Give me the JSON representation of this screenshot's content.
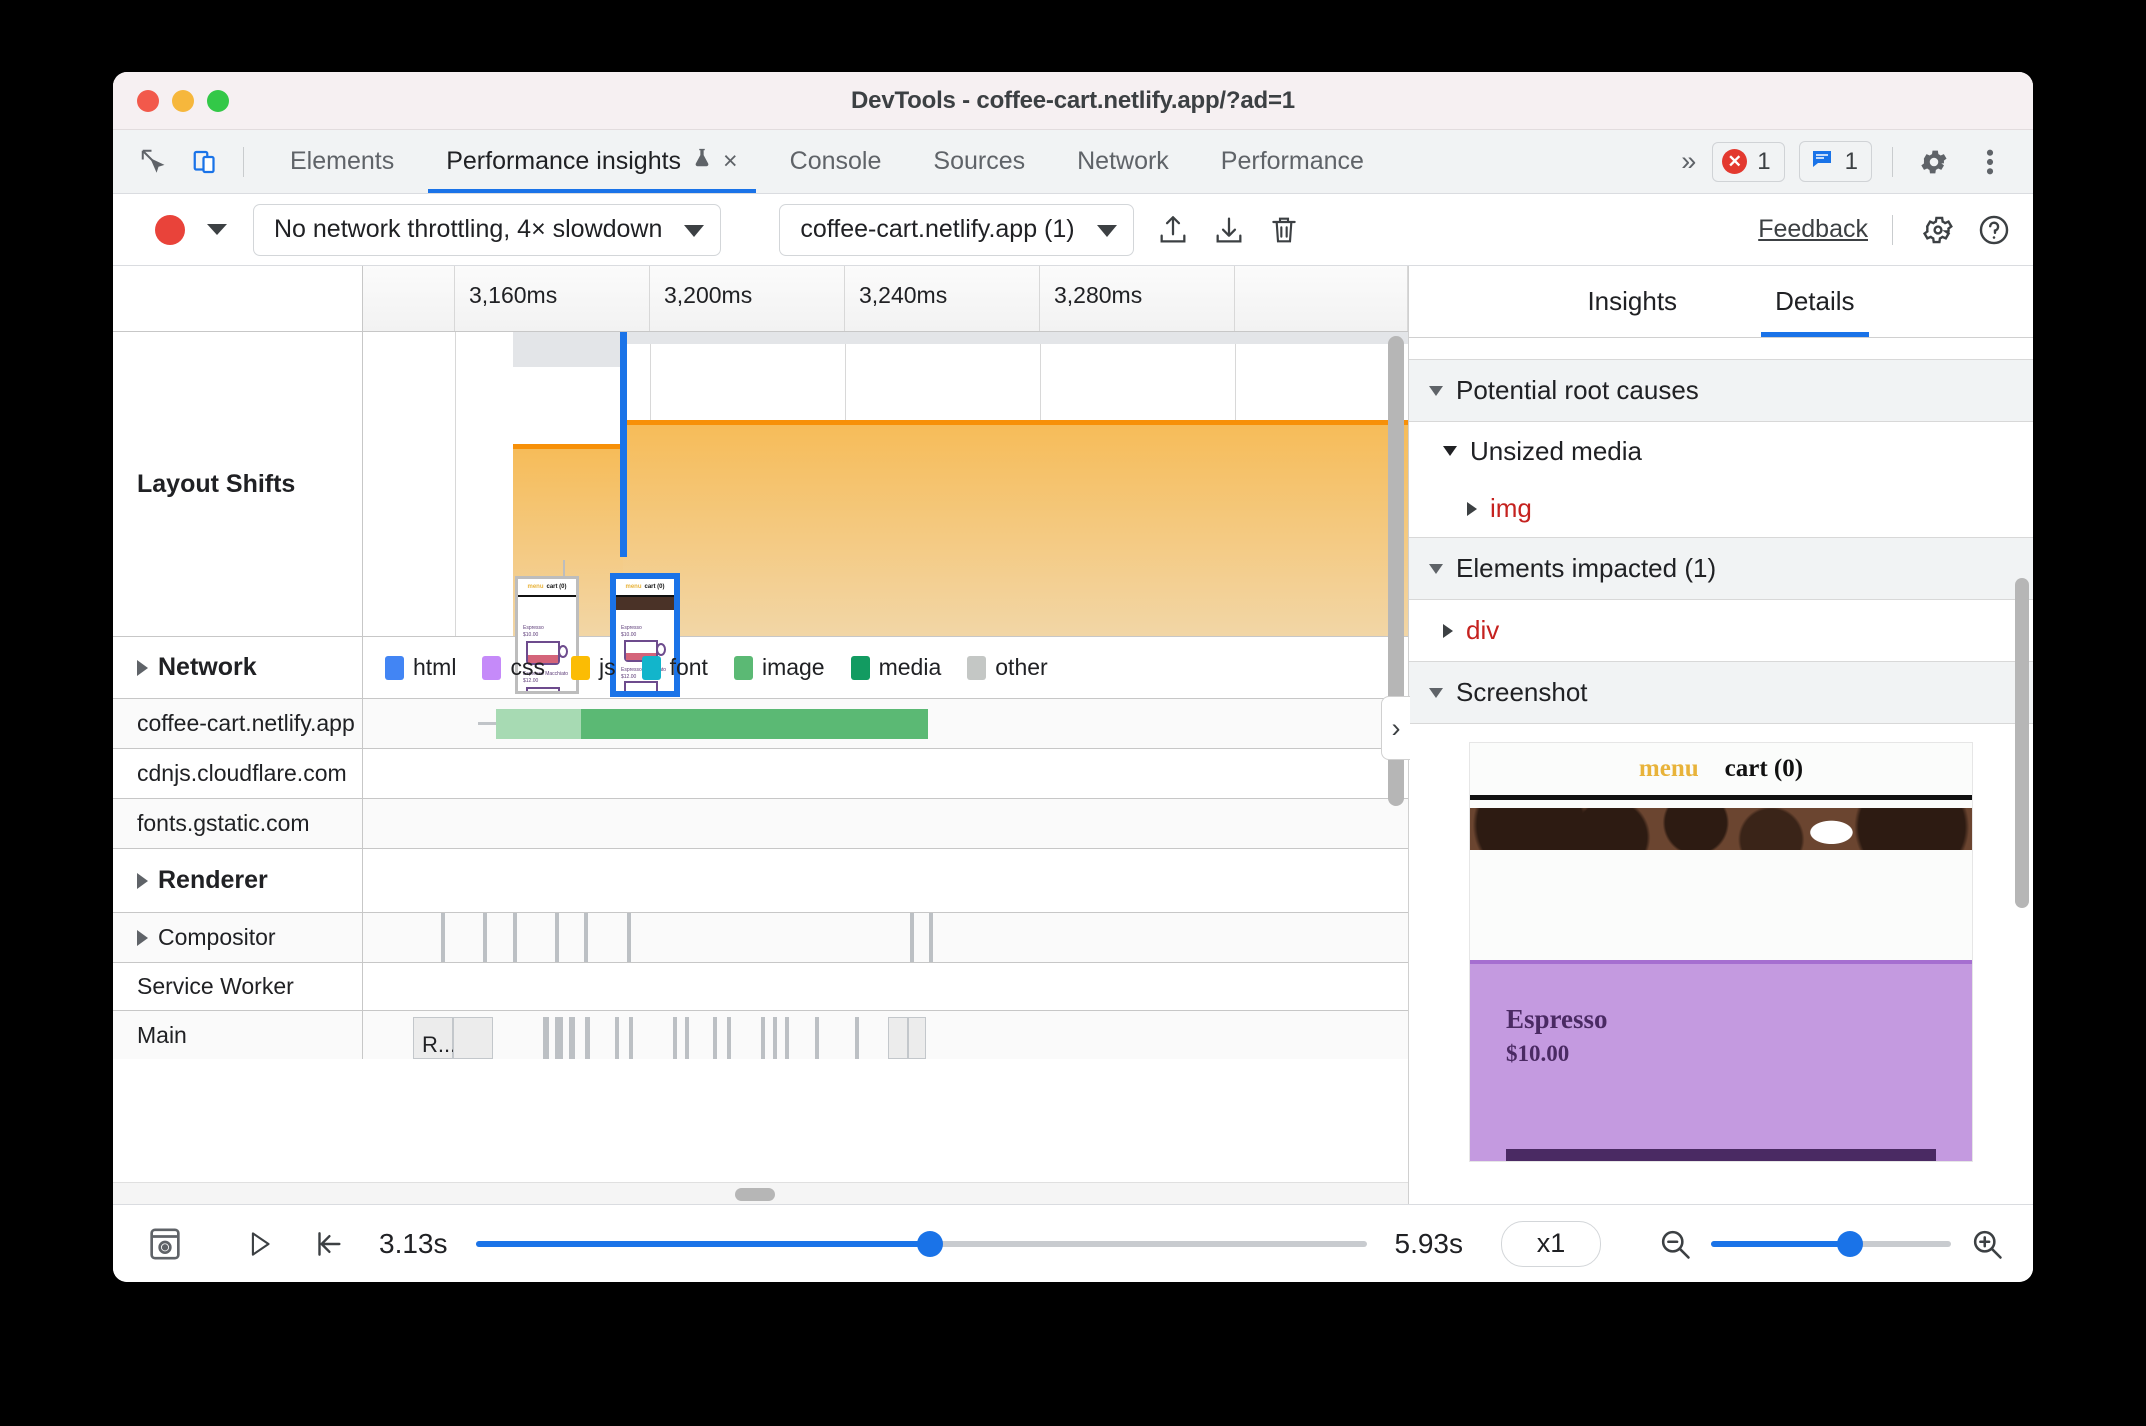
{
  "window": {
    "title": "DevTools - coffee-cart.netlify.app/?ad=1"
  },
  "tabbar": {
    "inspect_icon": "inspect-cursor-icon",
    "device_icon": "device-toolbar-icon",
    "tabs": [
      {
        "label": "Elements",
        "active": false
      },
      {
        "label": "Performance insights",
        "active": true,
        "experiment": true,
        "closable": true
      },
      {
        "label": "Console",
        "active": false
      },
      {
        "label": "Sources",
        "active": false
      },
      {
        "label": "Network",
        "active": false
      },
      {
        "label": "Performance",
        "active": false
      }
    ],
    "overflow_label": "»",
    "close_glyph": "×",
    "error_badge": {
      "count": "1",
      "icon": "error-circle-icon"
    },
    "message_badge": {
      "count": "1",
      "icon": "message-bubble-icon"
    },
    "settings_icon": "gear-icon",
    "more_icon": "more-vertical-icon"
  },
  "toolbar": {
    "record_label": "record-button",
    "throttling": "No network throttling, 4× slowdown",
    "target": "coffee-cart.netlify.app (1)",
    "upload_icon": "upload-icon",
    "download_icon": "download-icon",
    "trash_icon": "trash-icon",
    "feedback": "Feedback",
    "settings_icon": "gear-icon",
    "help_icon": "help-circle-icon"
  },
  "timeline": {
    "ticks": [
      "3,160ms",
      "3,200ms",
      "3,240ms",
      "3,280ms"
    ],
    "tracks": [
      {
        "name": "Layout Shifts",
        "bold": true,
        "expandable": false
      },
      {
        "name": "Network",
        "bold": true,
        "expandable": true
      },
      {
        "name": "coffee-cart.netlify.app",
        "bold": false,
        "expandable": false
      },
      {
        "name": "cdnjs.cloudflare.com",
        "bold": false,
        "expandable": false
      },
      {
        "name": "fonts.gstatic.com",
        "bold": false,
        "expandable": false
      },
      {
        "name": "Renderer",
        "bold": true,
        "expandable": true
      },
      {
        "name": "Compositor",
        "bold": false,
        "expandable": true
      },
      {
        "name": "Service Worker",
        "bold": false,
        "expandable": false
      },
      {
        "name": "Main",
        "bold": false,
        "expandable": false
      }
    ],
    "network_legend": [
      {
        "label": "html",
        "color": "#4285f4"
      },
      {
        "label": "css",
        "color": "#c58af9"
      },
      {
        "label": "js",
        "color": "#fbbc04"
      },
      {
        "label": "font",
        "color": "#12b5cb"
      },
      {
        "label": "image",
        "color": "#5bb974"
      },
      {
        "label": "media",
        "color": "#129b61"
      },
      {
        "label": "other",
        "color": "#c4c7c5"
      }
    ],
    "main_block_label": "R..."
  },
  "sidebar": {
    "tabs": [
      {
        "label": "Insights",
        "active": false
      },
      {
        "label": "Details",
        "active": true
      }
    ],
    "sections": [
      {
        "label": "Potential root causes"
      },
      {
        "label": "Elements impacted (1)"
      },
      {
        "label": "Screenshot"
      }
    ],
    "root_cause_group": "Unsized media",
    "root_cause_node": "img",
    "impacted_node": "div",
    "collapse_glyph": "›"
  },
  "screenshot_preview": {
    "menu": "menu",
    "cart": "cart (0)",
    "product": "Espresso",
    "price": "$10.00"
  },
  "bottombar": {
    "capture_icon": "screenshot-capture-icon",
    "play_icon": "play-icon",
    "rewind_icon": "jump-to-start-icon",
    "start_time": "3.13s",
    "end_time": "5.93s",
    "speed": "x1",
    "zoom_out_icon": "zoom-out-icon",
    "zoom_in_icon": "zoom-in-icon"
  },
  "colors": {
    "accent": "#1a73e8",
    "record": "#e9433a",
    "error": "#e3392f",
    "layout_shift": "#f79008",
    "node": "#c5221f"
  }
}
